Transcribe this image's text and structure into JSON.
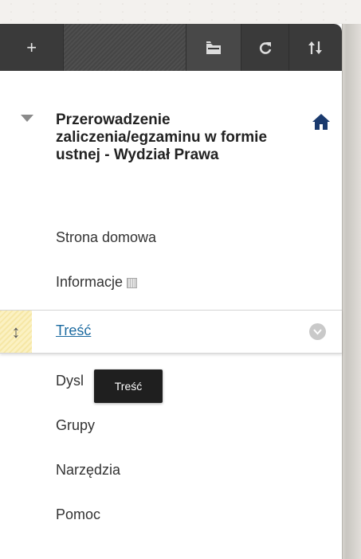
{
  "toolbar": {
    "add_label": "+",
    "folder_icon": "folder-icon",
    "refresh_icon": "refresh-icon",
    "sort_icon": "sort-icon"
  },
  "course": {
    "title": "Przerowadzenie zaliczenia/egzaminu w formie ustnej - Wydział Prawa",
    "home_icon": "home-icon"
  },
  "menu": {
    "items": [
      {
        "label": "Strona domowa"
      },
      {
        "label": "Informacje"
      },
      {
        "label": "Treść",
        "active": true
      },
      {
        "label": "Dysl"
      },
      {
        "label": "Grupy"
      },
      {
        "label": "Narzędzia"
      },
      {
        "label": "Pomoc"
      }
    ]
  },
  "tooltip": {
    "text": "Treść"
  },
  "colors": {
    "toolbar_bg": "#3a3a3a",
    "link": "#1b6aa0",
    "handle_bg": "#fbf1c2",
    "home_icon": "#1a3a6e"
  }
}
